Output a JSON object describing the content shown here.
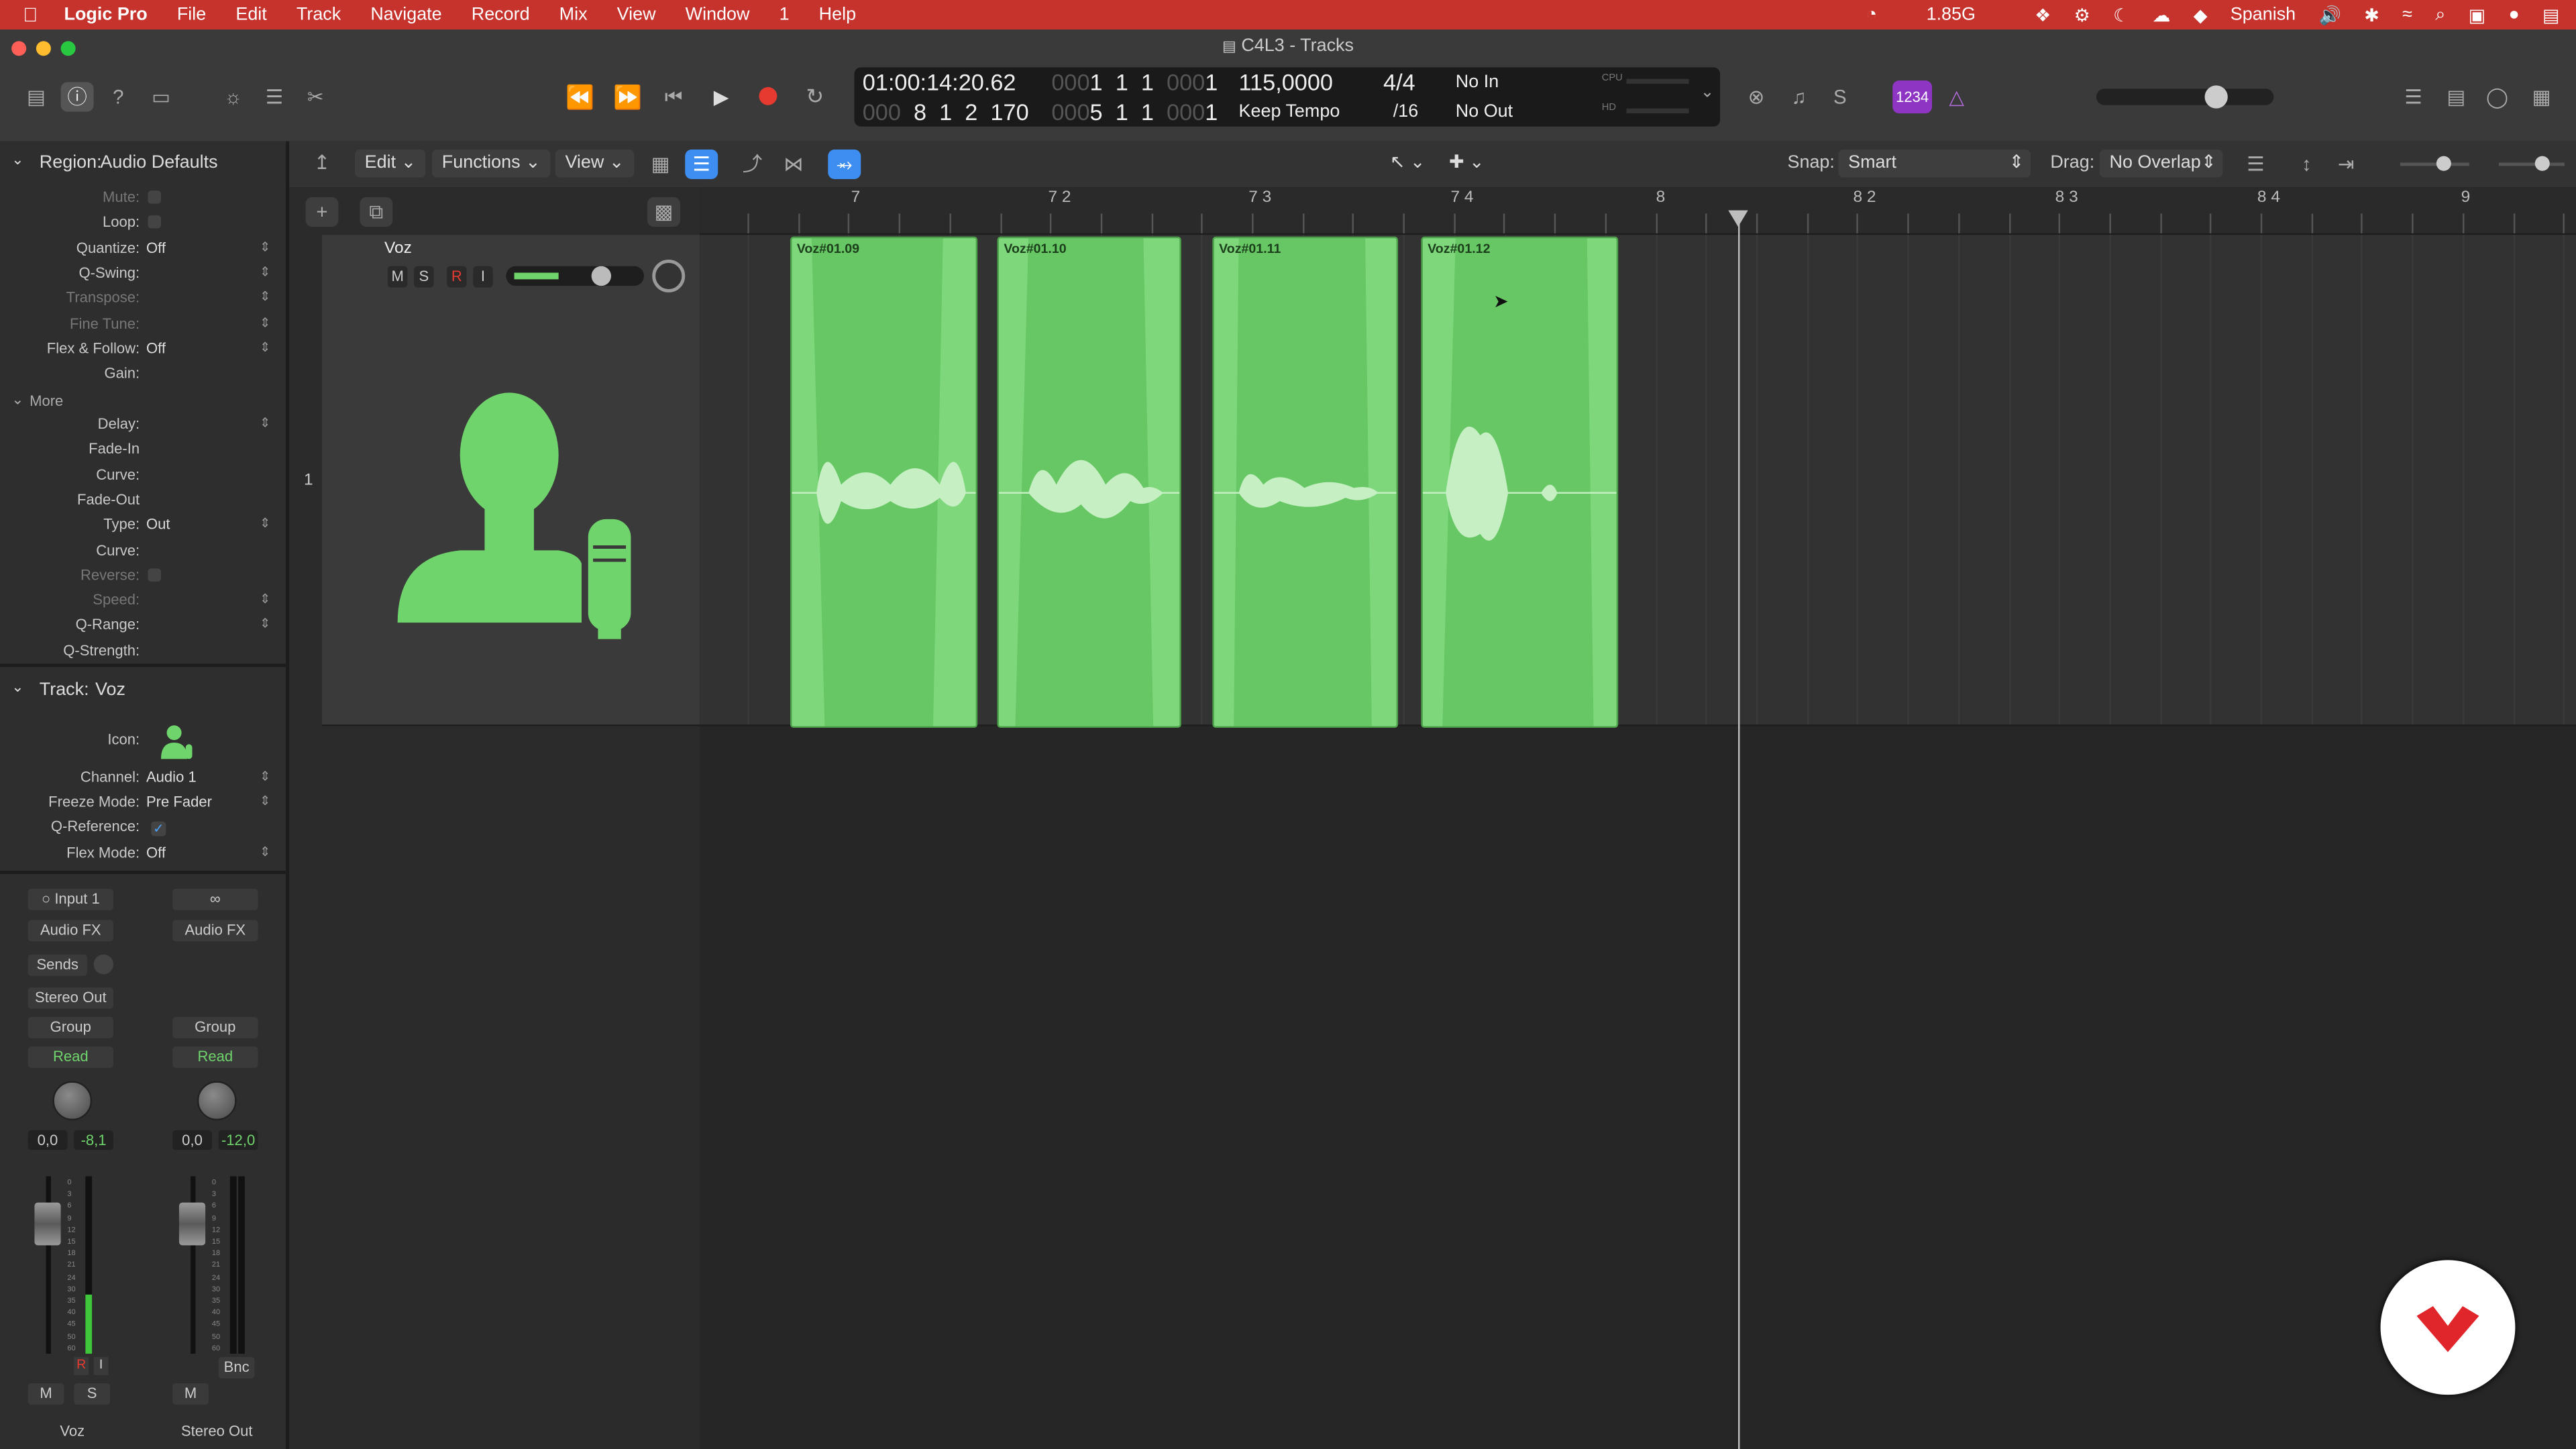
{
  "menubar": {
    "app": "Logic Pro",
    "items": [
      "File",
      "Edit",
      "Track",
      "Navigate",
      "Record",
      "Mix",
      "View",
      "Window",
      "1",
      "Help"
    ],
    "memory": "1.85G",
    "language": "Spanish"
  },
  "window": {
    "title": "C4L3 - Tracks"
  },
  "lcd": {
    "smpte": "01:00:14:20.62",
    "position": [
      "1",
      "1",
      "1",
      "1"
    ],
    "position_prefix": "000",
    "length": [
      "8",
      "1",
      "2",
      "170"
    ],
    "tempo": "115,0000",
    "tempo_mode": "Keep Tempo",
    "signature": "4/4",
    "division": "/16",
    "row1_right": [
      "1",
      "1",
      "1",
      "1"
    ],
    "row2_right": [
      "5",
      "1",
      "1",
      "1"
    ],
    "in": "No In",
    "out": "No Out",
    "cpu": "CPU",
    "hd": "HD"
  },
  "toolbar": {
    "lcd_badge": "1234"
  },
  "bar2": {
    "edit": "Edit",
    "functions": "Functions",
    "view": "View",
    "snap_label": "Snap:",
    "snap_value": "Smart",
    "drag_label": "Drag:",
    "drag_value": "No Overlap"
  },
  "inspector": {
    "region_header": "Region:",
    "region_name": "Audio Defaults",
    "region_rows": [
      {
        "label": "Mute:",
        "value": "",
        "dim": true
      },
      {
        "label": "Loop:",
        "value": "",
        "dim": false
      },
      {
        "label": "Quantize:",
        "value": "Off",
        "dim": false
      },
      {
        "label": "Q-Swing:",
        "value": "",
        "dim": false
      },
      {
        "label": "Transpose:",
        "value": "",
        "dim": true
      },
      {
        "label": "Fine Tune:",
        "value": "",
        "dim": true
      },
      {
        "label": "Flex & Follow:",
        "value": "Off",
        "dim": false
      },
      {
        "label": "Gain:",
        "value": "",
        "dim": false
      }
    ],
    "more_label": "More",
    "more_rows": [
      {
        "label": "Delay:",
        "value": "",
        "dim": false
      },
      {
        "label": "Fade-In",
        "value": "",
        "dim": false
      },
      {
        "label": "Curve:",
        "value": "",
        "dim": false
      },
      {
        "label": "Fade-Out",
        "value": "",
        "dim": false
      },
      {
        "label": "Type:",
        "value": "Out",
        "dim": false
      },
      {
        "label": "Curve:",
        "value": "",
        "dim": false
      },
      {
        "label": "Reverse:",
        "value": "",
        "dim": true
      },
      {
        "label": "Speed:",
        "value": "",
        "dim": true
      },
      {
        "label": "Q-Range:",
        "value": "",
        "dim": false
      },
      {
        "label": "Q-Strength:",
        "value": "",
        "dim": false
      }
    ],
    "track_header": "Track:",
    "track_name": "Voz",
    "track_rows": [
      {
        "label": "Icon:",
        "value": ""
      },
      {
        "label": "Channel:",
        "value": "Audio 1"
      },
      {
        "label": "Freeze Mode:",
        "value": "Pre Fader"
      },
      {
        "label": "Q-Reference:",
        "value": ""
      },
      {
        "label": "Flex Mode:",
        "value": "Off"
      }
    ]
  },
  "strips": [
    {
      "input": "Input 1",
      "fx": "Audio FX",
      "sends": "Sends",
      "output": "Stereo Out",
      "group": "Group",
      "auto": "Read",
      "pan_val": "0,0",
      "peak": "-8,1",
      "m": "M",
      "s": "S",
      "r": "R",
      "i": "I",
      "name": "Voz"
    },
    {
      "input": "",
      "fx": "Audio FX",
      "sends": "",
      "output": "",
      "group": "Group",
      "auto": "Read",
      "pan_val": "0,0",
      "peak": "-12,0",
      "m": "M",
      "s": "",
      "bnc": "Bnc",
      "name": "Stereo Out"
    }
  ],
  "meter_scale": [
    "0",
    "3",
    "6",
    "9",
    "12",
    "15",
    "18",
    "21",
    "24",
    "30",
    "35",
    "40",
    "45",
    "50",
    "60"
  ],
  "track": {
    "number": "1",
    "name": "Voz",
    "m": "M",
    "s": "S",
    "r": "R",
    "i": "I"
  },
  "ruler": {
    "labels": [
      "7",
      "7 2",
      "7 3",
      "7 4",
      "8",
      "8 2",
      "8 3",
      "8 4",
      "9"
    ]
  },
  "regions": [
    {
      "name": "Voz#01.09"
    },
    {
      "name": "Voz#01.10"
    },
    {
      "name": "Voz#01.11"
    },
    {
      "name": "Voz#01.12"
    }
  ],
  "colors": {
    "menubar": "#c6322c",
    "region": "#67c764",
    "accent": "#3d8ef0"
  }
}
